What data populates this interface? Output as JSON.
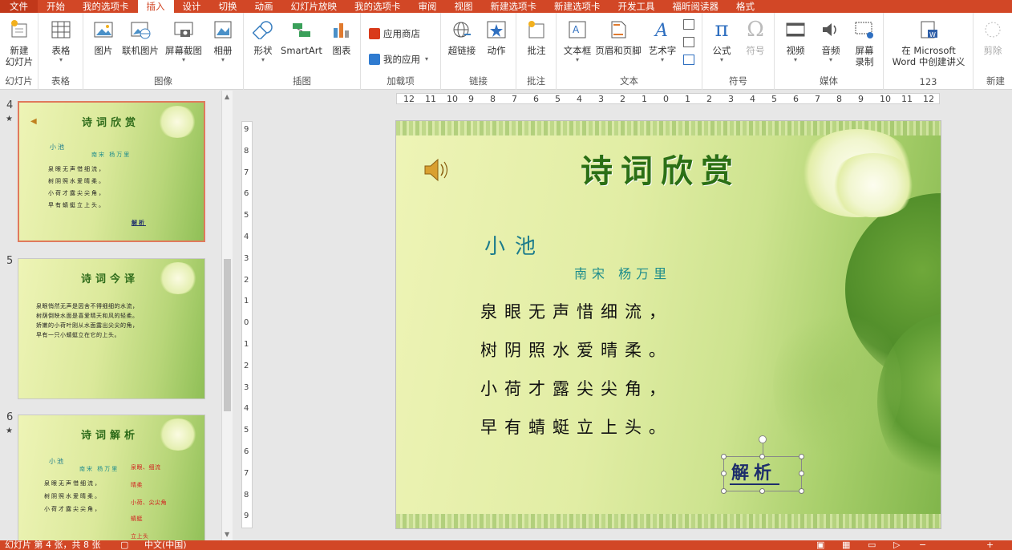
{
  "tabs": [
    "文件",
    "开始",
    "我的选项卡",
    "插入",
    "设计",
    "切换",
    "动画",
    "幻灯片放映",
    "我的选项卡",
    "审阅",
    "视图",
    "新建选项卡",
    "新建选项卡",
    "开发工具",
    "福昕阅读器",
    "格式"
  ],
  "active_tab": "插入",
  "ribbon": {
    "groups": {
      "slides": "幻灯片",
      "tables": "表格",
      "images": "图像",
      "illustrations": "插图",
      "addins": "加载项",
      "links": "链接",
      "comments": "批注",
      "text": "文本",
      "symbols": "符号",
      "media": "媒体",
      "custom": "123",
      "new": "新建"
    },
    "buttons": {
      "new_slide": "新建",
      "new_slide2": "幻灯片",
      "table": "表格",
      "picture": "图片",
      "online_picture": "联机图片",
      "screenshot": "屏幕截图",
      "album": "相册",
      "shapes": "形状",
      "smartart": "SmartArt",
      "chart": "图表",
      "app_store": "应用商店",
      "my_apps": "我的应用",
      "hyperlink": "超链接",
      "action": "动作",
      "comment": "批注",
      "textbox": "文本框",
      "header_footer": "页眉和页脚",
      "wordart": "艺术字",
      "equation": "公式",
      "symbol": "符号",
      "video": "视频",
      "audio": "音频",
      "screen_record": "屏幕",
      "screen_record2": "录制",
      "word_handout": "在 Microsoft",
      "word_handout2": "Word 中创建讲义",
      "trim": "剪除"
    }
  },
  "thumbnails": [
    {
      "number": "4",
      "star": "★",
      "title": "诗词欣赏",
      "lines": [
        "小池",
        "南宋 杨万里",
        "泉眼无声惜细流，",
        "树阴照水爱晴柔。",
        "小荷才露尖尖角，",
        "早有蜻蜓立上头。",
        "解析"
      ]
    },
    {
      "number": "5",
      "star": "",
      "title": "诗词今译",
      "lines": [
        "泉眼悄然无声是因舍不得细细的水流，",
        "树荫倒映水面是喜爱晴天和风的轻柔。",
        "娇嫩的小荷叶刚从水面露出尖尖的角，",
        "早有一只小蜻蜓立在它的上头。"
      ]
    },
    {
      "number": "6",
      "star": "★",
      "title": "诗词解析",
      "lines": [
        "小池",
        "南宋 杨万里",
        "泉眼无声惜细流，",
        "树阴照水爱晴柔。",
        "小荷才露尖尖角，"
      ],
      "red": [
        "泉眼、细流",
        "晴柔",
        "小荷、尖尖角",
        "蜻蜓",
        "立上头"
      ]
    }
  ],
  "slide": {
    "title": "诗词欣赏",
    "poem_title": "小池",
    "author": "南宋 杨万里",
    "lines": [
      "泉眼无声惜细流，",
      "树阴照水爱晴柔。",
      "小荷才露尖尖角，",
      "早有蜻蜓立上头。"
    ],
    "analysis": "解析"
  },
  "hruler": [
    "12",
    "11",
    "10",
    "9",
    "8",
    "7",
    "6",
    "5",
    "4",
    "3",
    "2",
    "1",
    "0",
    "1",
    "2",
    "3",
    "4",
    "5",
    "6",
    "7",
    "8",
    "9",
    "10",
    "11",
    "12"
  ],
  "vruler": [
    "9",
    "8",
    "7",
    "6",
    "5",
    "4",
    "3",
    "2",
    "1",
    "0",
    "1",
    "2",
    "3",
    "4",
    "5",
    "6",
    "7",
    "8",
    "9"
  ],
  "status": {
    "slide_info": "幻灯片 第 4 张，共 8 张",
    "language": "中文(中国)"
  },
  "colors": {
    "accent": "#d24726",
    "title_green": "#2b6f15",
    "poem_teal": "#1d7c8c"
  }
}
